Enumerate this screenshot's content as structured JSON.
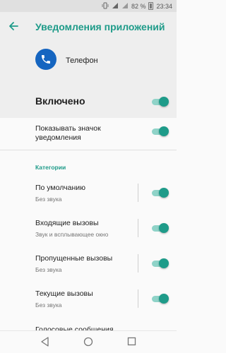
{
  "status_bar": {
    "battery_percent": "82 %",
    "time": "23:34"
  },
  "header": {
    "title": "Уведомления приложений",
    "app_name": "Телефон"
  },
  "main_toggle": {
    "label": "Включено",
    "on": true
  },
  "show_badge": {
    "label_line1": "Показывать значок",
    "label_line2": "уведомления",
    "on": true
  },
  "categories": {
    "header": "Категории",
    "items": [
      {
        "title": "По умолчанию",
        "subtitle": "Без звука",
        "on": true
      },
      {
        "title": "Входящие вызовы",
        "subtitle": "Звук и всплывающее окно",
        "on": true
      },
      {
        "title": "Пропущенные вызовы",
        "subtitle": "Без звука",
        "on": true
      },
      {
        "title": "Текущие вызовы",
        "subtitle": "Без звука",
        "on": true
      },
      {
        "title": "Голосовые сообщения",
        "subtitle": "",
        "on": true
      }
    ]
  },
  "colors": {
    "accent": "#1e9b89",
    "app_icon_bg": "#1565c0"
  }
}
